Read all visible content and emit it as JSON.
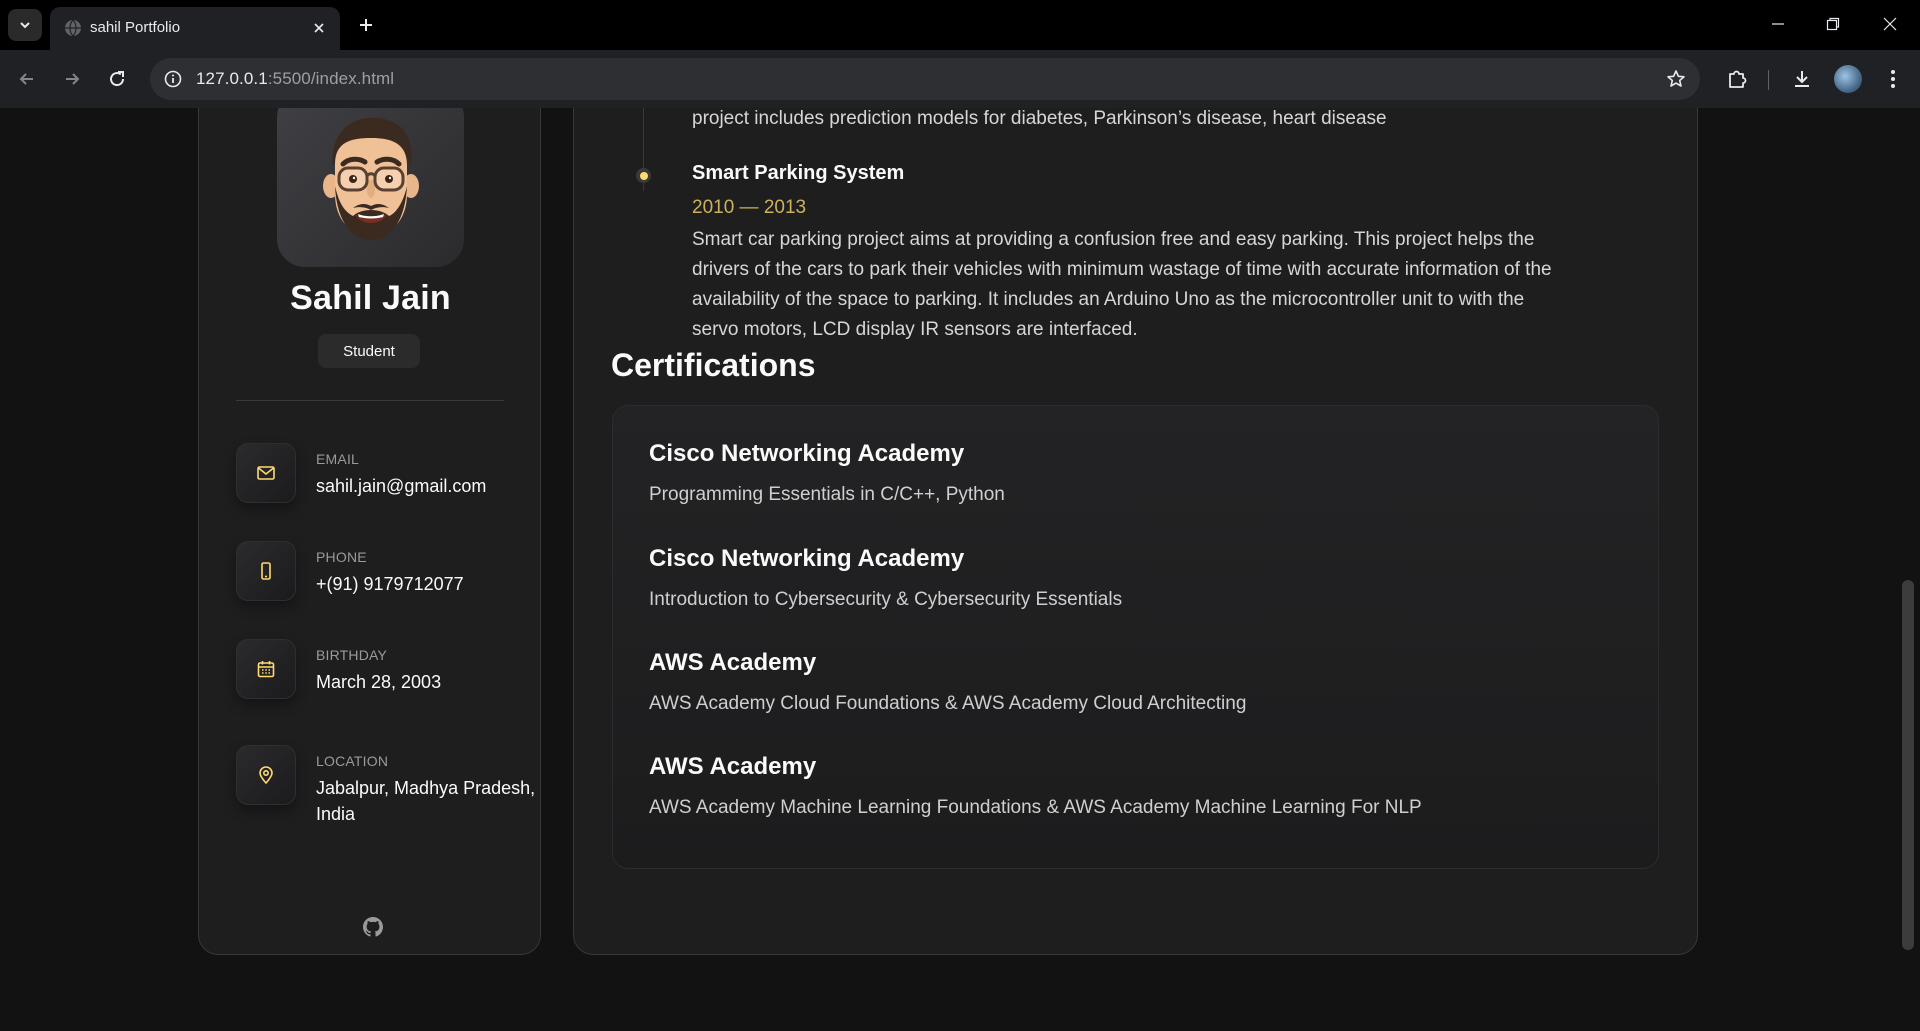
{
  "browser": {
    "tab_title": "sahil Portfolio",
    "url_host": "127.0.0.1",
    "url_rest": ":5500/index.html"
  },
  "profile": {
    "name": "Sahil Jain",
    "role": "Student",
    "contacts": [
      {
        "label": "Email",
        "value": "sahil.jain@gmail.com",
        "icon": "mail-icon"
      },
      {
        "label": "Phone",
        "value": "+(91) 9179712077",
        "icon": "phone-icon"
      },
      {
        "label": "Birthday",
        "value": "March 28, 2003",
        "icon": "calendar-icon"
      },
      {
        "label": "Location",
        "value": "Jabalpur, Madhya Pradesh, India",
        "icon": "location-icon"
      }
    ]
  },
  "timeline": {
    "previous_text": "project includes prediction models for diabetes, Parkinson’s disease, heart disease",
    "item": {
      "title": "Smart Parking System",
      "date": "2010 — 2013",
      "text": "Smart car parking project aims at providing a confusion free and easy parking. This project helps the drivers of the cars to park their vehicles with minimum wastage of time with accurate information of the availability of the space to parking. It includes an Arduino Uno as the microcontroller unit to with the servo motors, LCD display IR sensors are interfaced."
    }
  },
  "certifications": {
    "title": "Certifications",
    "items": [
      {
        "name": "Cisco Networking Academy",
        "desc": "Programming Essentials in C/C++, Python"
      },
      {
        "name": "Cisco Networking Academy",
        "desc": "Introduction to Cybersecurity & Cybersecurity Essentials"
      },
      {
        "name": "AWS Academy",
        "desc": "AWS Academy Cloud Foundations & AWS Academy Cloud Architecting"
      },
      {
        "name": "AWS Academy",
        "desc": "AWS Academy Machine Learning Foundations & AWS Academy Machine Learning For NLP"
      }
    ]
  },
  "colors": {
    "accent": "#ffdb70",
    "background": "#121212",
    "card": "#1e1e1f"
  }
}
